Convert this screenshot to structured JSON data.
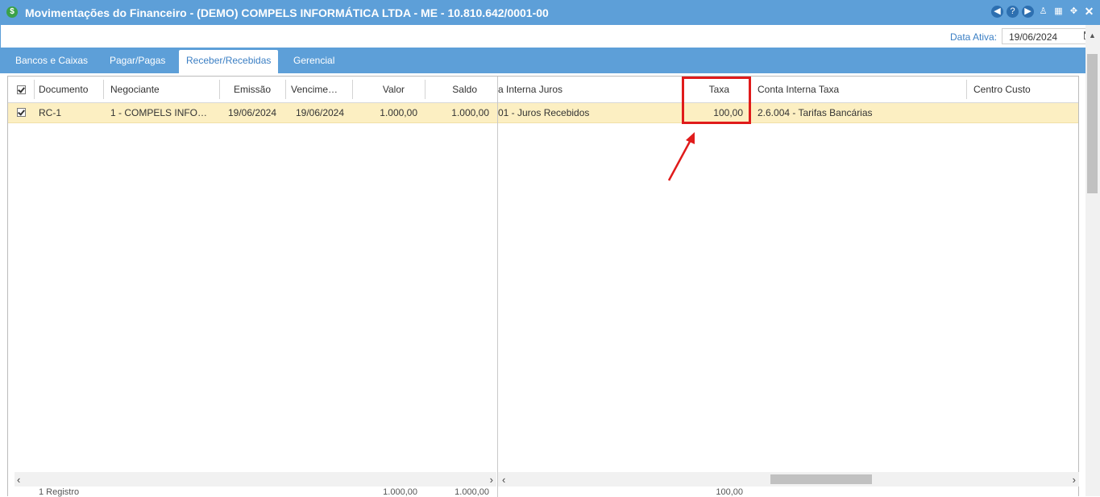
{
  "window": {
    "title": "Movimentações do Financeiro - (DEMO) COMPELS INFORMÁTICA LTDA - ME - 10.810.642/0001-00",
    "icon": "dollar-icon",
    "buttons": [
      "back-icon",
      "help-icon",
      "play-icon",
      "user-icon",
      "calendar-icon",
      "restore-icon",
      "close-icon"
    ]
  },
  "active_date": {
    "label": "Data Ativa:",
    "value": "19/06/2024"
  },
  "tabs": [
    {
      "label": "Bancos e Caixas"
    },
    {
      "label": "Pagar/Pagas"
    },
    {
      "label": "Receber/Recebidas"
    },
    {
      "label": "Gerencial"
    }
  ],
  "active_tab": "Receber/Recebidas",
  "grid": {
    "columns_left": [
      "Documento",
      "Negociante",
      "Emissão",
      "Vencime…",
      "Valor",
      "Saldo"
    ],
    "columns_right": [
      "a Interna Juros",
      "Taxa",
      "Conta Interna Taxa",
      "Centro Custo"
    ],
    "rows": [
      {
        "checked": true,
        "documento": "RC-1",
        "negociante": "1 - COMPELS INFO…",
        "emissao": "19/06/2024",
        "vencimento": "19/06/2024",
        "valor": "1.000,00",
        "saldo": "1.000,00",
        "conta_juros": "01 - Juros Recebidos",
        "taxa": "100,00",
        "conta_taxa": "2.6.004 - Tarifas Bancárias",
        "centro_custo": ""
      }
    ],
    "footer": {
      "label": "1 Registro",
      "valor": "1.000,00",
      "saldo": "1.000,00",
      "taxa": "100,00"
    }
  },
  "annotation": {
    "highlight_color": "#e01b1b"
  },
  "colors": {
    "header_blue": "#5d9fd8",
    "selected_row": "#fcefc2",
    "accent": "#3b7fc4"
  }
}
